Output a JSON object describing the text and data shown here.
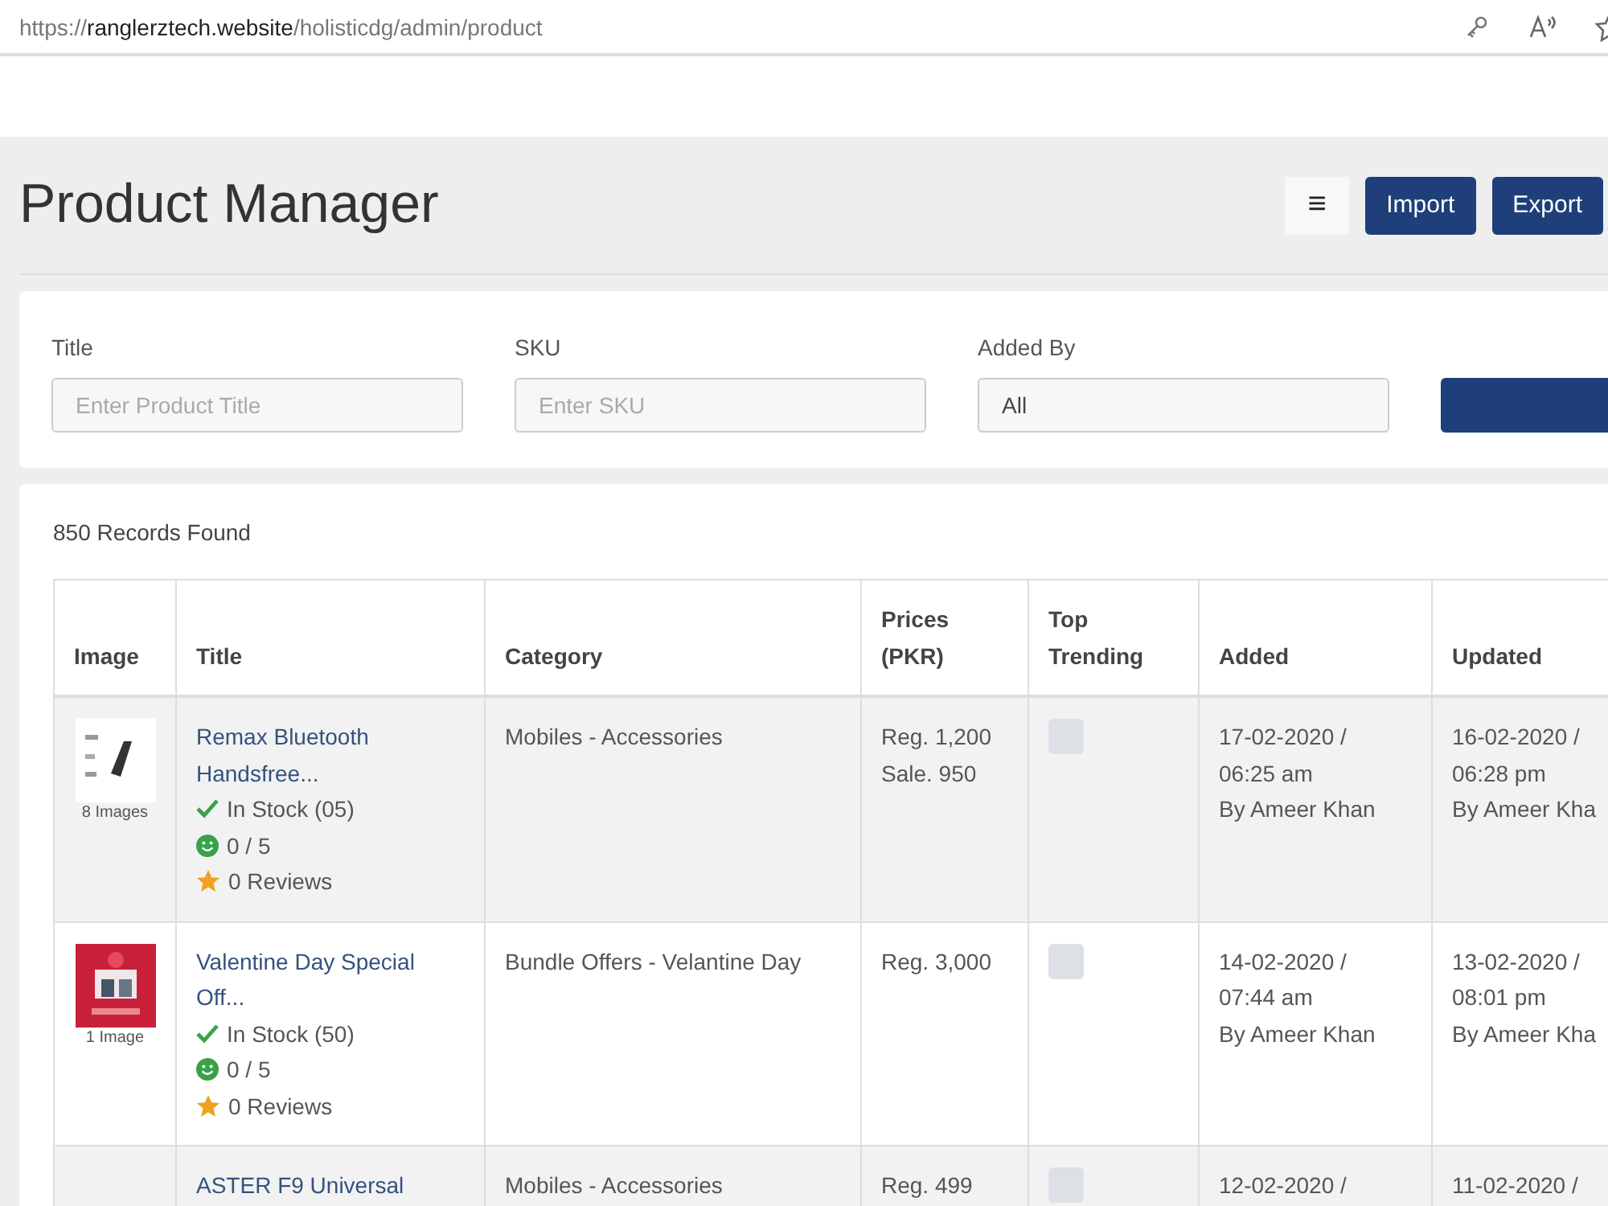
{
  "browser": {
    "url": "https://**ranglerztech.website**/holisticdg/admin/product"
  },
  "header": {
    "title": "Product Manager",
    "menu_icon": "≡",
    "buttons": [
      "Import",
      "Export"
    ]
  },
  "filters": [
    {
      "label": "Title",
      "placeholder": "Enter Product Title",
      "kind": "input"
    },
    {
      "label": "SKU",
      "placeholder": "Enter SKU",
      "kind": "input"
    },
    {
      "label": "Added By",
      "value": "All",
      "kind": "select"
    }
  ],
  "records": "850 Records Found",
  "table": {
    "columns": [
      "Image",
      "Title",
      "Category",
      "Prices (PKR)",
      "Top Trending",
      "Added",
      "Updated"
    ],
    "rows": [
      {
        "image": "8 Images",
        "title": "Remax Bluetooth Handsfree...",
        "stock": "In Stock (05)",
        "rating": "0 / 5",
        "reviews": "0 Reviews",
        "category": "Mobiles - Accessories",
        "prices": [
          "Reg. 1,200",
          "Sale. 950"
        ],
        "top_trending": false,
        "added": [
          "17-02-2020 /",
          "06:25 am",
          "By Ameer Khan"
        ],
        "updated": [
          "16-02-2020 /",
          "06:28 pm",
          "By Ameer Kha"
        ]
      },
      {
        "image": "1 Image",
        "title": "Valentine Day Special Off...",
        "stock": "In Stock (50)",
        "rating": "0 / 5",
        "reviews": "0 Reviews",
        "category": "Bundle Offers - Velantine Day",
        "prices": [
          "Reg. 3,000"
        ],
        "top_trending": false,
        "added": [
          "14-02-2020 /",
          "07:44 am",
          "By Ameer Khan"
        ],
        "updated": [
          "13-02-2020 /",
          "08:01 pm",
          "By Ameer Kha"
        ]
      },
      {
        "title": "ASTER F9 Universal",
        "category": "Mobiles - Accessories",
        "prices": [
          "Reg. 499"
        ],
        "top_trending": false,
        "added": [
          "12-02-2020 /"
        ],
        "updated": [
          "11-02-2020 /"
        ]
      }
    ]
  }
}
